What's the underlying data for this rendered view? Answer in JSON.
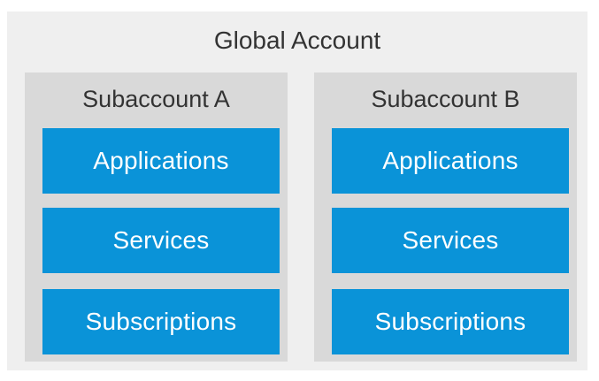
{
  "global_account": {
    "title": "Global Account"
  },
  "subaccounts": [
    {
      "title": "Subaccount A",
      "items": [
        "Applications",
        "Services",
        "Subscriptions"
      ]
    },
    {
      "title": "Subaccount B",
      "items": [
        "Applications",
        "Services",
        "Subscriptions"
      ]
    }
  ],
  "colors": {
    "global_background": "#efefef",
    "subaccount_background": "#d9d9d9",
    "item_background": "#0a93d8",
    "item_text": "#ffffff",
    "title_text": "#333333"
  }
}
